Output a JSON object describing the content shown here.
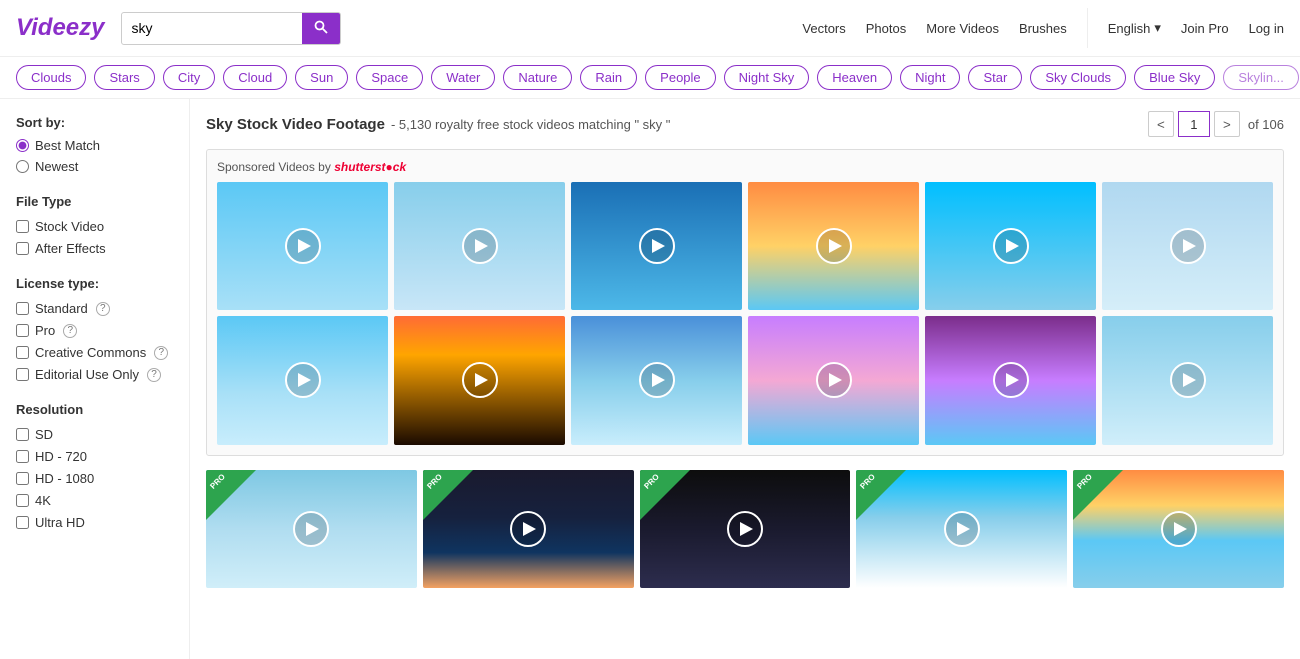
{
  "header": {
    "logo": "Videezy",
    "search": {
      "value": "sky",
      "placeholder": "sky"
    },
    "nav": {
      "vectors": "Vectors",
      "photos": "Photos",
      "more_videos": "More Videos",
      "brushes": "Brushes",
      "language": "English",
      "join_pro": "Join Pro",
      "login": "Log in"
    }
  },
  "tags": {
    "items": [
      "Clouds",
      "Stars",
      "City",
      "Cloud",
      "Sun",
      "Space",
      "Water",
      "Nature",
      "Rain",
      "People",
      "Night Sky",
      "Heaven",
      "Night",
      "Star",
      "Sky Clouds",
      "Blue Sky",
      "Skyline"
    ]
  },
  "sidebar": {
    "sort_label": "Sort by:",
    "sort_options": [
      "Best Match",
      "Newest"
    ],
    "file_type_label": "File Type",
    "file_types": [
      "Stock Video",
      "After Effects"
    ],
    "license_label": "License type:",
    "licenses": [
      {
        "label": "Standard",
        "has_help": true
      },
      {
        "label": "Pro",
        "has_help": true
      },
      {
        "label": "Creative Commons",
        "has_help": true
      },
      {
        "label": "Editorial Use Only",
        "has_help": true
      }
    ],
    "resolution_label": "Resolution",
    "resolutions": [
      "SD",
      "HD - 720",
      "HD - 1080",
      "4K",
      "Ultra HD"
    ]
  },
  "results": {
    "title": "Sky Stock Video Footage",
    "count_text": "- 5,130 royalty free stock videos matching \" sky \"",
    "page": "1",
    "total_pages": "of 106"
  },
  "sponsored": {
    "label": "Sponsored Videos by",
    "brand": "shutterstock"
  },
  "pagination": {
    "prev": "<",
    "next": ">"
  },
  "pro_badge": "PRO"
}
